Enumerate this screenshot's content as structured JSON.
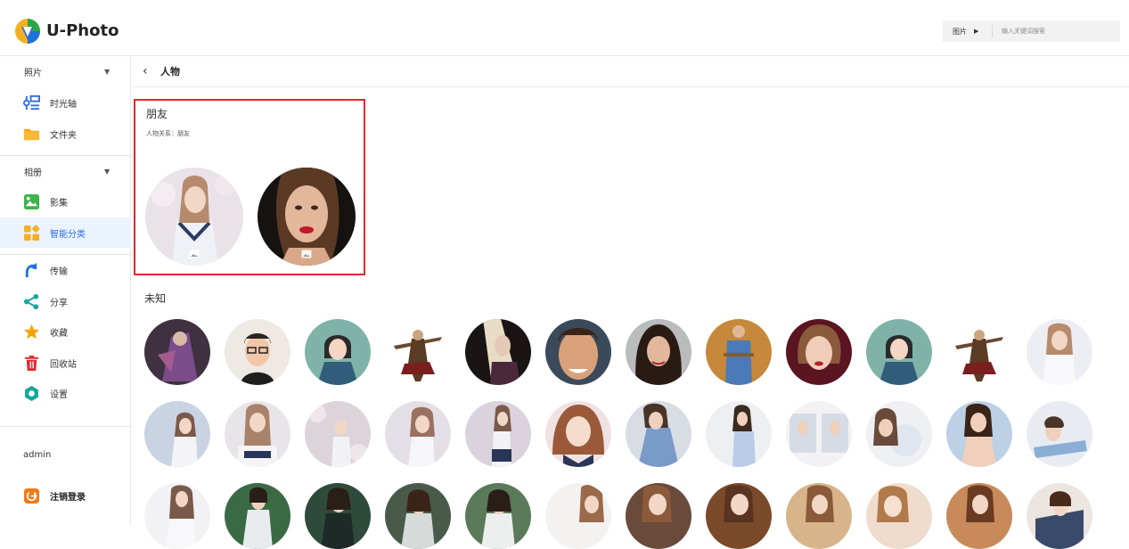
{
  "app": {
    "name": "U-Photo"
  },
  "search": {
    "type_label": "图片",
    "placeholder": "输入关键词搜索"
  },
  "sidebar": {
    "photos_header": "照片",
    "albums_header": "相册",
    "items": [
      {
        "label": "时光轴",
        "icon": "timeline-icon"
      },
      {
        "label": "文件夹",
        "icon": "folder-icon"
      },
      {
        "label": "影集",
        "icon": "album-icon"
      },
      {
        "label": "智能分类",
        "icon": "smart-category-icon"
      },
      {
        "label": "传输",
        "icon": "transfer-icon"
      },
      {
        "label": "分享",
        "icon": "share-icon"
      },
      {
        "label": "收藏",
        "icon": "star-icon"
      },
      {
        "label": "回收站",
        "icon": "trash-icon"
      },
      {
        "label": "设置",
        "icon": "settings-icon"
      }
    ],
    "user": "admin",
    "logout": "注销登录"
  },
  "main": {
    "back_icon": "‹",
    "title": "人物",
    "friends": {
      "title": "朋友",
      "subtitle": "人物关系：朋友"
    },
    "unknown": {
      "title": "未知"
    }
  },
  "colors": {
    "accent": "#2f6fde",
    "highlight_border": "#e0282e",
    "active_bg": "#ebf3ff"
  }
}
